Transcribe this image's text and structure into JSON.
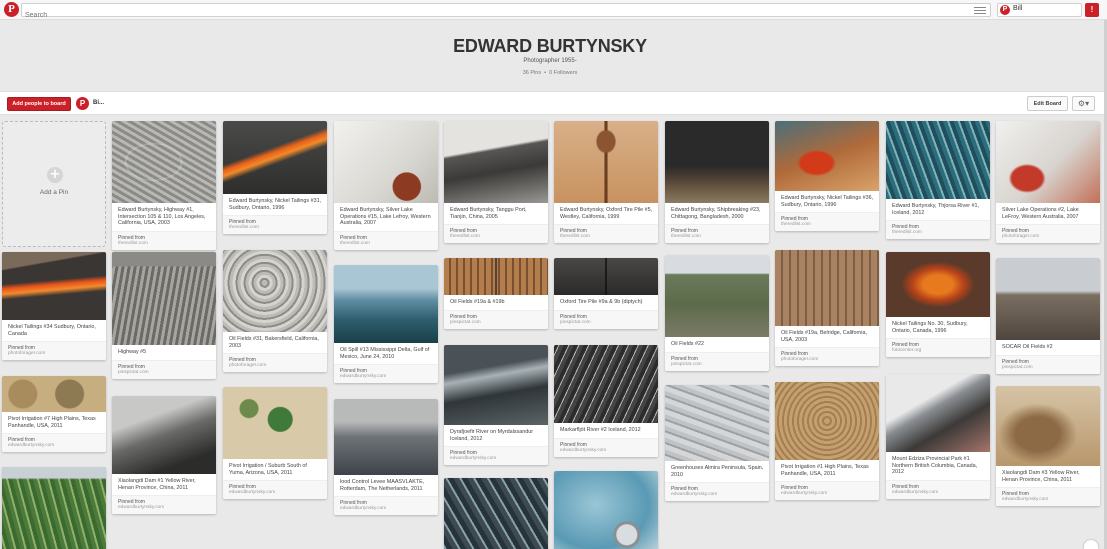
{
  "nav": {
    "logo": "P",
    "search_placeholder": "Search",
    "user_name": "Bill",
    "user_initial": "P",
    "notifications": "!"
  },
  "board": {
    "title": "EDWARD BURTYNSKY",
    "description": "Photographer 1955-",
    "pins_count": "36 Pins",
    "separator": "•",
    "followers_count": "0 Followers",
    "add_people_label": "Add people to board",
    "owner_initial": "P",
    "owner_name": "Bi...",
    "edit_label": "Edit Board",
    "gear_label": "⚙▾"
  },
  "add_pin": {
    "label": "Add a Pin",
    "plus": "+"
  },
  "pinned_from_label": "Pinned from",
  "pins": [
    {
      "desc": "Edward Burtynsky, Highway #1, Intersection 105 & 110, Los Angeles, California, USA, 2003",
      "source": "theredlist.com"
    },
    {
      "desc": "Edward Burtynsky, Nickel Tailings #31, Sudbury, Ontario, 1996",
      "source": "theredlist.com"
    },
    {
      "desc": "Edward Burtynsky, Silver Lake Operations #15, Lake Lefroy, Western Australia, 2007",
      "source": "theredlist.com"
    },
    {
      "desc": "Edward Burtynsky, Tanggu Port, Tianjin, China, 2005",
      "source": "theredlist.com"
    },
    {
      "desc": "Edward Burtynsky, Oxford Tire Pile #5, Westley, California, 1999",
      "source": "theredlist.com"
    },
    {
      "desc": "Edward Burtynsky, Shipbreaking #23, Chittagong, Bangladesh, 2000",
      "source": "theredlist.com"
    },
    {
      "desc": "Edward Burtynsky, Nickel Tailings #36, Sudbury, Ontario, 1996",
      "source": "theredlist.com"
    },
    {
      "desc": "Edward Burtynsky, Thjorsa River #1, Iceland, 2012",
      "source": "theredlist.com"
    },
    {
      "desc": "Silver Lake Operations #2, Lake LeFroy, Western Australia, 2007",
      "source": "photoforager.com"
    },
    {
      "desc": "Nickel Tailings #34 Sudbury, Ontario, Canada",
      "source": "photoforager.com"
    },
    {
      "desc": "Highway #5",
      "source": "pinspictat.com"
    },
    {
      "desc": "Oil Fields #31, Bakersfield, California, 2003",
      "source": "photoforager.com"
    },
    {
      "desc": "Oil Spill #13 Mississippi Delta, Gulf of Mexico, June 24, 2010",
      "source": "edwardburtynsky.com"
    },
    {
      "desc": "Oil Fields #19a & #19b",
      "source": "pinspictat.com"
    },
    {
      "desc": "Oxford Tire Pile #9a & 9b (diptych)",
      "source": "pinspictat.com"
    },
    {
      "desc": "Oil Fields #22",
      "source": "pinspictat.com"
    },
    {
      "desc": "Oil Fields #19a, Belridge, California, USA, 2003",
      "source": "photoforager.com"
    },
    {
      "desc": "Nickel Tailings No. 30, Sudbury, Ontario, Canada, 1996",
      "source": "fotocenter.org"
    },
    {
      "desc": "SOCAR Oil Fields #2",
      "source": "pinspictat.com"
    },
    {
      "desc": "Pivot Irrigation #7 High Plains, Texas Panhandle, USA, 2011",
      "source": "edwardburtynsky.com"
    },
    {
      "desc": "Xiaolangdi Dam #1 Yellow River, Henan Province, China, 2011",
      "source": "edwardburtynsky.com"
    },
    {
      "desc": "Pivot Irrigation / Suburb South of Yuma, Arizona, USA, 2011",
      "source": "edwardburtynsky.com"
    },
    {
      "desc": "lood Control Levee MAASVLAKTE, Rotterdam, The Netherlands, 2011",
      "source": "edwardburtynsky.com"
    },
    {
      "desc": "Dyrafjoefir River on Myrdalssandur Iceland, 2012",
      "source": "edwardburtynsky.com"
    },
    {
      "desc": "Markarfljót River #2 Iceland, 2012",
      "source": "edwardburtynsky.com"
    },
    {
      "desc": "Greenhouses Almira Peninsula, Spain, 2010",
      "source": "edwardburtynsky.com"
    },
    {
      "desc": "Pivot Irrigation #1 High Plains, Texas Panhandle, USA, 2011",
      "source": "edwardburtynsky.com"
    },
    {
      "desc": "Mount Edziza Provincial Park #1 Northern British Columbia, Canada, 2012",
      "source": "edwardburtynsky.com"
    },
    {
      "desc": "Xiaolangdi Dam #3 Yellow River, Henan Province, China, 2011",
      "source": "edwardburtynsky.com"
    }
  ],
  "colors": {
    "brand_red": "#cb2027",
    "background": "#e9e9e9"
  }
}
